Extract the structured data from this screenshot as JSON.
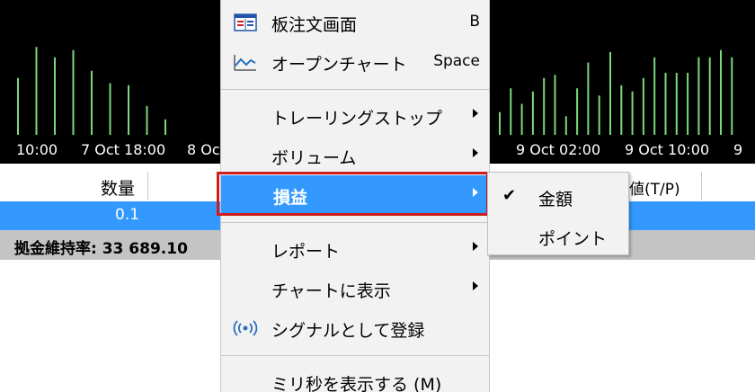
{
  "chart": {
    "time_labels": [
      "10:00",
      "7 Oct 18:00",
      "8 Oc",
      "9 Oct 02:00",
      "9 Oct 10:00",
      "9"
    ],
    "bar_heights": [
      0.55,
      0.85,
      0.75,
      0.82,
      0.62,
      0.5,
      0.48,
      0.28,
      0.15,
      0.22,
      0.45,
      0.3,
      0.42,
      0.55,
      0.58,
      0.18,
      0.45,
      0.7,
      0.38,
      0.8,
      0.48,
      0.42,
      0.55,
      0.75,
      0.6,
      0.6,
      0.6,
      0.75,
      0.75,
      0.82,
      0.75
    ],
    "bar_color": "#7dd87d"
  },
  "table": {
    "header_qty": "数量",
    "header_tp": "値(T/P)",
    "row_qty": "0.1",
    "summary": "拠金維持率: 33 689.10"
  },
  "menu": {
    "item_order_book": {
      "label": "板注文画面",
      "shortcut": "B"
    },
    "item_open_chart": {
      "label": "オープンチャート",
      "shortcut": "Space"
    },
    "item_trailing_stop": {
      "label": "トレーリングストップ"
    },
    "item_volume": {
      "label": "ボリューム"
    },
    "item_pl": {
      "label": "損益"
    },
    "item_report": {
      "label": "レポート"
    },
    "item_show_on_chart": {
      "label": "チャートに表示"
    },
    "item_signal": {
      "label": "シグナルとして登録"
    },
    "item_millis": {
      "label": "ミリ秒を表示する (M)"
    }
  },
  "submenu": {
    "item_amount": {
      "label": "金額",
      "checked": "✔"
    },
    "item_points": {
      "label": "ポイント"
    }
  },
  "colors": {
    "selection": "#3399ff",
    "highlight_border": "#d01c1c"
  }
}
